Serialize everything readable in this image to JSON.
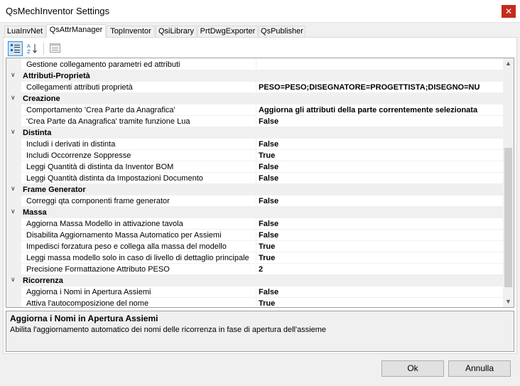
{
  "window": {
    "title": "QsMechInventor Settings",
    "close_glyph": "✕"
  },
  "tabs": [
    "LuaInvNet",
    "QsAttrManager",
    "TopInventor",
    "QsiLibrary",
    "PrtDwgExporter",
    "QsPublisher"
  ],
  "toolbar": {
    "categorized_icon": "categorized-icon",
    "alphabetical_icon": "sort-az-icon",
    "pages_icon": "property-pages-icon"
  },
  "grid": {
    "rows": [
      {
        "kind": "prop",
        "name": "Gestione collegamento parametri ed attributi",
        "value": ""
      },
      {
        "kind": "cat",
        "name": "Attributi-Proprietà"
      },
      {
        "kind": "prop",
        "name": "Collegamenti attributi proprietà",
        "value": "PESO=PESO;DISEGNATORE=PROGETTISTA;DISEGNO=NU"
      },
      {
        "kind": "cat",
        "name": "Creazione"
      },
      {
        "kind": "prop",
        "name": "Comportamento 'Crea Parte da Anagrafica'",
        "value": "Aggiorna gli attributi della parte correntemente selezionata"
      },
      {
        "kind": "prop",
        "name": "'Crea Parte da Anagrafica' tramite funzione Lua",
        "value": "False"
      },
      {
        "kind": "cat",
        "name": "Distinta"
      },
      {
        "kind": "prop",
        "name": "Includi i derivati in distinta",
        "value": "False"
      },
      {
        "kind": "prop",
        "name": "Includi Occorrenze Soppresse",
        "value": "True"
      },
      {
        "kind": "prop",
        "name": "Leggi Quantità di distinta da Inventor BOM",
        "value": "False"
      },
      {
        "kind": "prop",
        "name": "Leggi Quantità distinta da Impostazioni Documento",
        "value": "False"
      },
      {
        "kind": "cat",
        "name": "Frame Generator"
      },
      {
        "kind": "prop",
        "name": "Correggi qta componenti frame generator",
        "value": "False"
      },
      {
        "kind": "cat",
        "name": "Massa"
      },
      {
        "kind": "prop",
        "name": "Aggiorna Massa Modello in attivazione tavola",
        "value": "False"
      },
      {
        "kind": "prop",
        "name": "Disabilita Aggiornamento Massa Automatico per Assiemi",
        "value": "False"
      },
      {
        "kind": "prop",
        "name": "Impedisci forzatura peso e collega alla massa del modello",
        "value": "True"
      },
      {
        "kind": "prop",
        "name": "Leggi massa modello solo in caso di livello di dettaglio principale",
        "value": "True"
      },
      {
        "kind": "prop",
        "name": "Precisione Formattazione Attributo PESO",
        "value": "2"
      },
      {
        "kind": "cat",
        "name": "Ricorrenza"
      },
      {
        "kind": "prop",
        "name": "Aggiorna i Nomi in Apertura Assiemi",
        "value": "False"
      },
      {
        "kind": "prop",
        "name": "Attiva l'autocomposizione del nome",
        "value": "True"
      }
    ]
  },
  "help": {
    "title": "Aggiorna i Nomi in Apertura Assiemi",
    "description": "Abilita l'aggiornamento automatico dei nomi delle ricorrenza in fase di apertura dell'assieme"
  },
  "buttons": {
    "ok": "Ok",
    "cancel": "Annulla"
  }
}
